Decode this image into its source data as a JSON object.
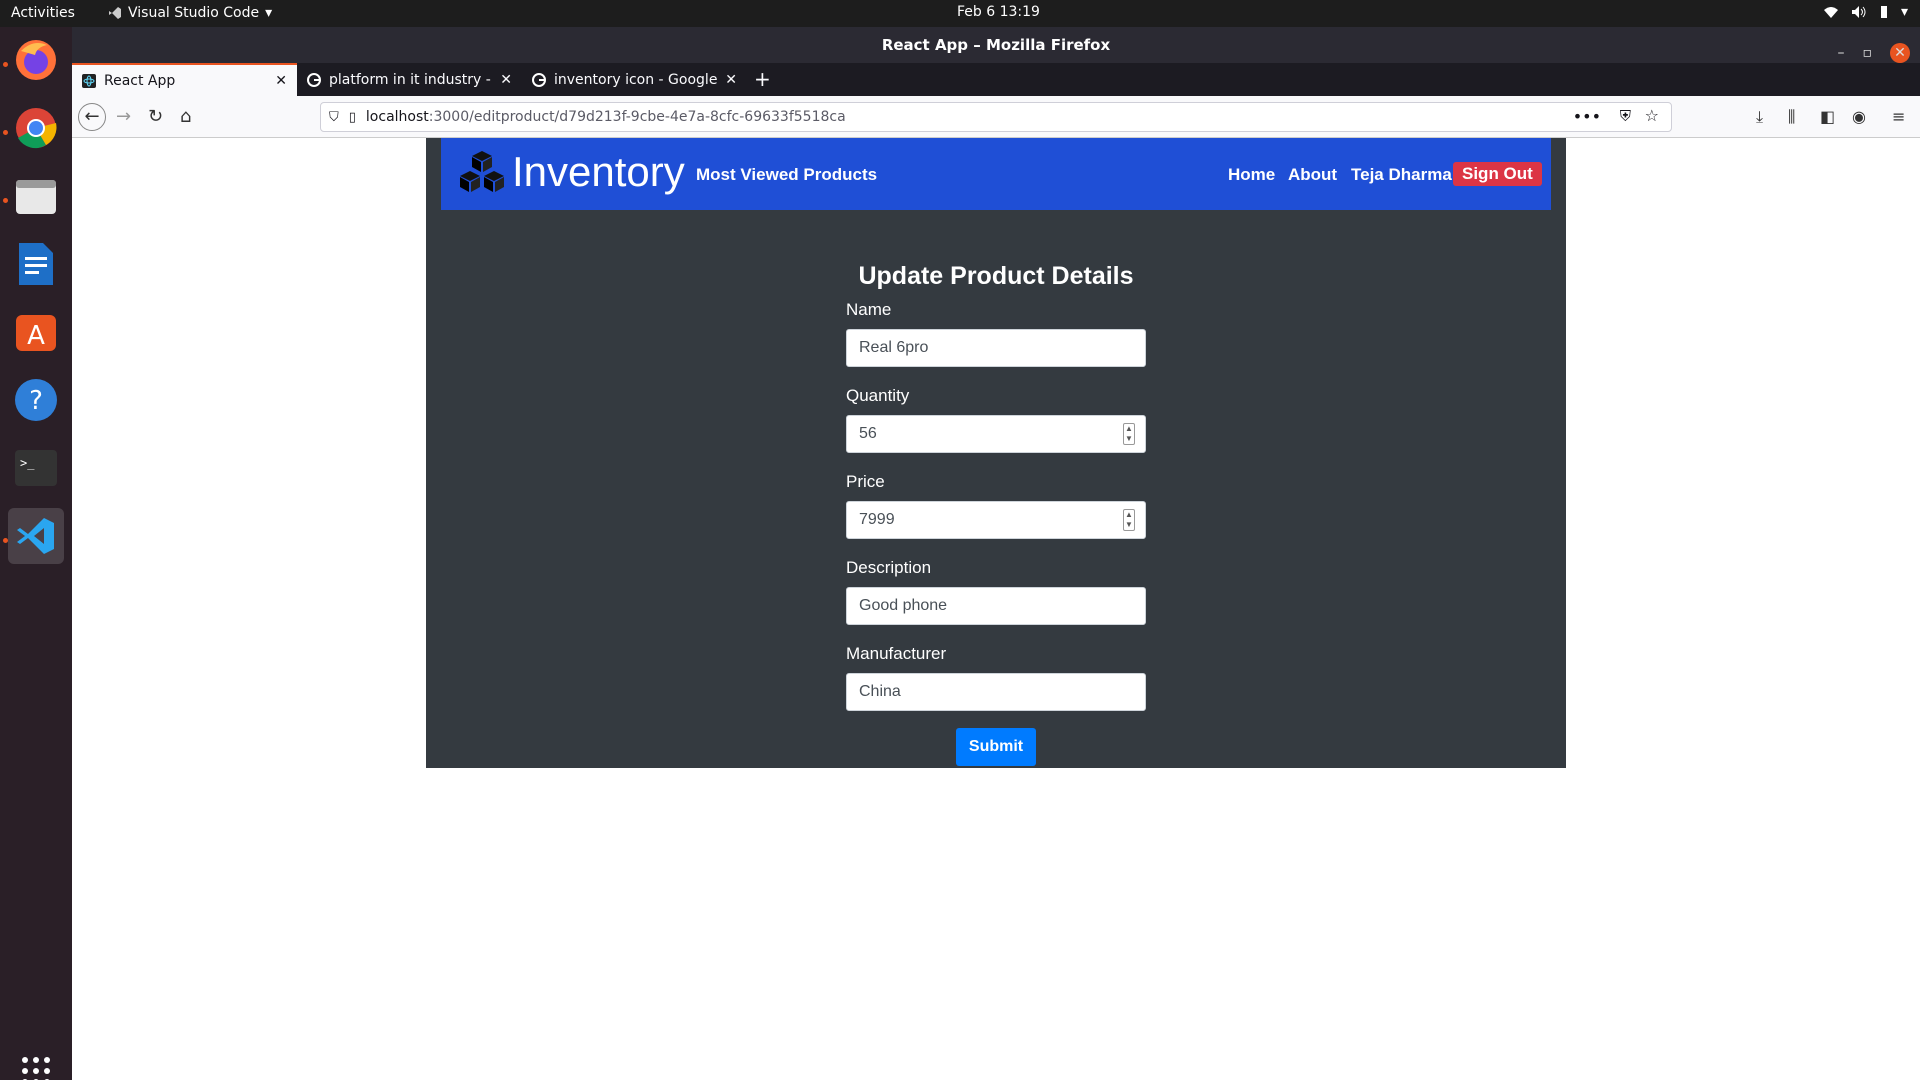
{
  "system": {
    "activities": "Activities",
    "app_menu": "Visual Studio Code",
    "clock": "Feb 6  13:19"
  },
  "window": {
    "title": "React App – Mozilla Firefox"
  },
  "tabs": [
    {
      "title": "React App",
      "favicon": "react-icon"
    },
    {
      "title": "platform in it industry - G",
      "favicon": "google-icon"
    },
    {
      "title": "inventory icon - Google S",
      "favicon": "google-icon"
    }
  ],
  "url": {
    "host": "localhost",
    "path": ":3000/editproduct/d79d213f-9cbe-4e7a-8cfc-69633f5518ca"
  },
  "navbar": {
    "brand": "Inventory",
    "most_viewed": "Most Viewed Products",
    "home": "Home",
    "about": "About",
    "user": "Teja Dharma",
    "sign_out": "Sign Out"
  },
  "form": {
    "title": "Update Product Details",
    "fields": {
      "name": {
        "label": "Name",
        "value": "Real 6pro"
      },
      "quantity": {
        "label": "Quantity",
        "value": "56"
      },
      "price": {
        "label": "Price",
        "value": "7999"
      },
      "description": {
        "label": "Description",
        "value": "Good phone"
      },
      "manufacturer": {
        "label": "Manufacturer",
        "value": "China"
      }
    },
    "submit": "Submit"
  },
  "colors": {
    "nav_bg": "#1f4fd6",
    "app_bg": "#343a40",
    "signout_bg": "#dc3545",
    "submit_bg": "#007bff"
  }
}
